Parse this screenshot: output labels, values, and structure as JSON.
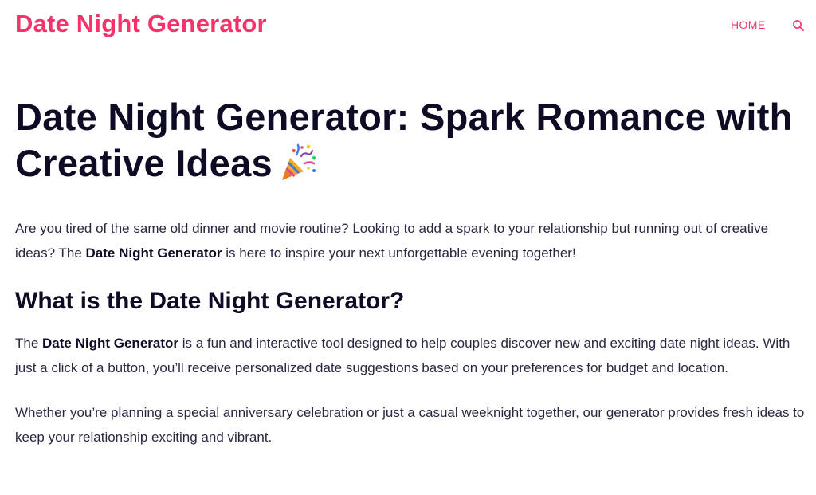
{
  "header": {
    "site_title": "Date Night Generator",
    "nav": {
      "home_label": "HOME"
    },
    "search_icon": "search-icon"
  },
  "colors": {
    "brand": "#f5336b",
    "heading": "#0e0c24",
    "body_text": "#2a2840",
    "background": "#ffffff"
  },
  "article": {
    "title": "Date Night Generator: Spark Romance with Creative Ideas",
    "title_emoji": "party-popper-icon",
    "intro": {
      "before": "Are you tired of the same old dinner and movie routine? Looking to add a spark to your relationship but running out of creative ideas? The ",
      "bold": "Date Night Generator",
      "after": " is here to inspire your next unforgettable evening together!"
    },
    "section_heading": "What is the Date Night Generator?",
    "what_paragraph": {
      "before": "The ",
      "bold": "Date Night Generator",
      "after": " is a fun and interactive tool designed to help couples discover new and exciting date night ideas. With just a click of a button, you’ll receive personalized date suggestions based on your preferences for budget and location."
    },
    "whether_paragraph": "Whether you’re planning a special anniversary celebration or just a casual weeknight together, our generator provides fresh ideas to keep your relationship exciting and vibrant."
  }
}
